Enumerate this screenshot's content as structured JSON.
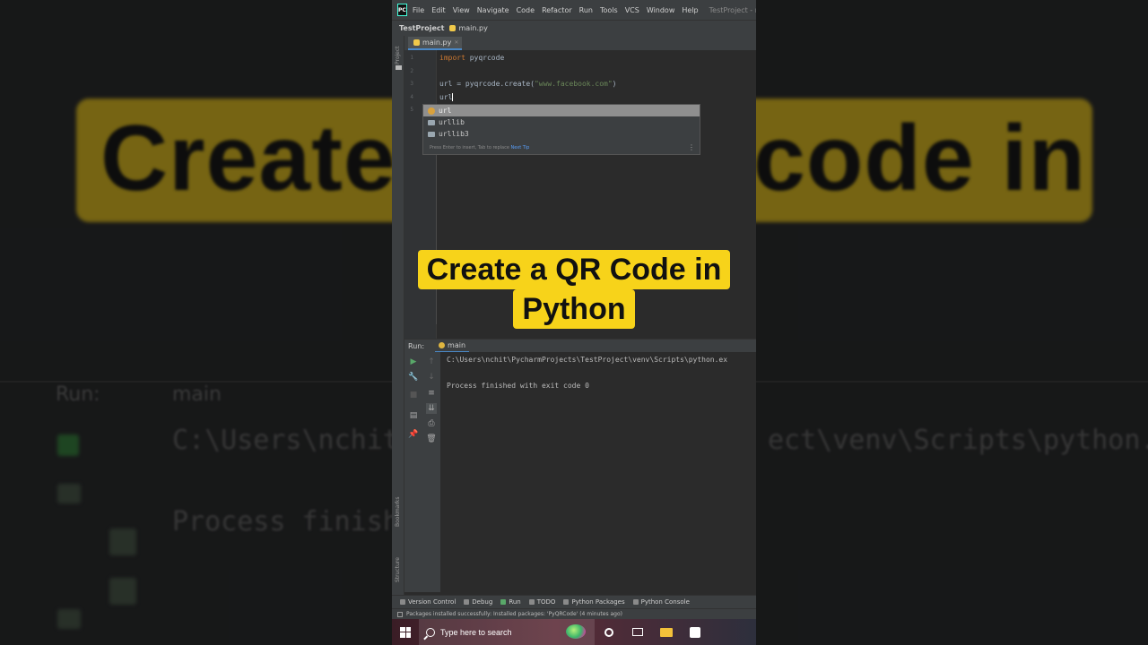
{
  "background": {
    "left_text": "Create",
    "right_text": "code in",
    "run_label": "Run:",
    "run_tab": "main",
    "path_left": "C:\\Users\\nchit\\",
    "path_right": "ect\\venv\\Scripts\\python.ex",
    "process_left": "Process finishe"
  },
  "menubar": {
    "items": [
      "File",
      "Edit",
      "View",
      "Navigate",
      "Code",
      "Refactor",
      "Run",
      "Tools",
      "VCS",
      "Window",
      "Help"
    ],
    "project_title": "TestProject - ma"
  },
  "navbar": {
    "project": "TestProject",
    "file": "main.py"
  },
  "sidebar": {
    "project_label": "Project",
    "bookmarks_label": "Bookmarks",
    "structure_label": "Structure"
  },
  "editor": {
    "tab": "main.py",
    "line_numbers": [
      "1",
      "2",
      "3",
      "4",
      "5"
    ],
    "line1_kw": "import",
    "line1_rest": " pyqrcode",
    "line3_pre": "url = pyqrcode.create(",
    "line3_str": "\"www.facebook.com\"",
    "line3_post": ")",
    "line4": "url"
  },
  "autocomplete": {
    "items": [
      "url",
      "urllib",
      "urllib3"
    ],
    "footer": "Press Enter to insert, Tab to replace",
    "tip": "Next Tip"
  },
  "overlay": {
    "line1": "Create a QR Code in",
    "line2": "Python"
  },
  "run": {
    "label": "Run:",
    "tab": "main",
    "command": "C:\\Users\\nchit\\PycharmProjects\\TestProject\\venv\\Scripts\\python.ex",
    "result": "Process finished with exit code 0"
  },
  "toolstrip": [
    "Version Control",
    "Debug",
    "Run",
    "TODO",
    "Python Packages",
    "Python Console"
  ],
  "status": "Packages installed successfully: Installed packages: 'PyQRCode' (4 minutes ago)",
  "taskbar": {
    "search_placeholder": "Type here to search"
  },
  "colors": {
    "accent_yellow": "#f7d31a",
    "editor_bg": "#2b2b2b",
    "keyword": "#cc7832",
    "string": "#6a8759"
  }
}
